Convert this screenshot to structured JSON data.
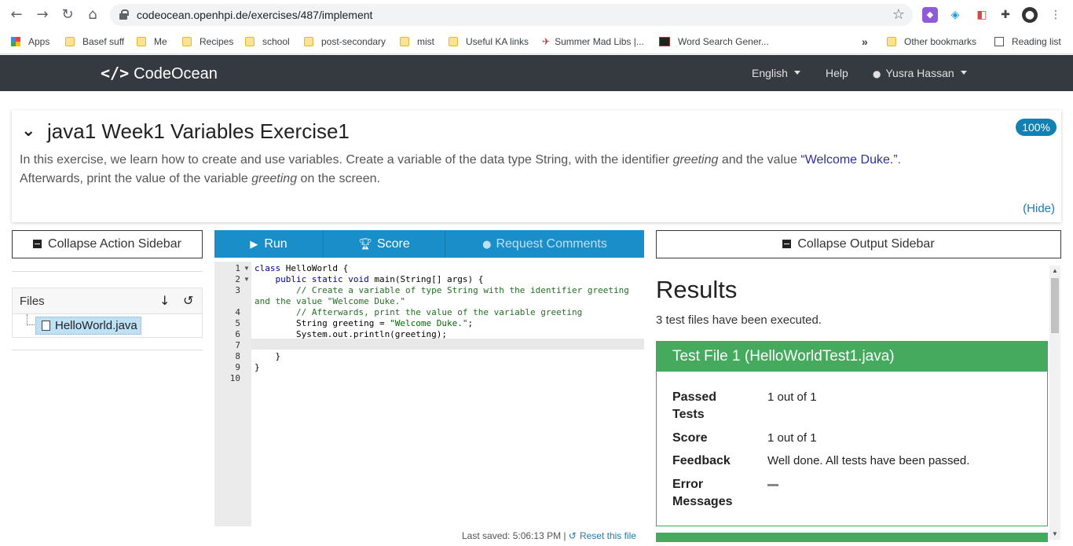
{
  "browser": {
    "url": "codeocean.openhpi.de/exercises/487/implement",
    "bookmarks": [
      "Apps",
      "Basef suff",
      "Me",
      "Recipes",
      "school",
      "post-secondary",
      "mist",
      "Useful KA links",
      "Summer Mad Libs |...",
      "Word Search Gener...",
      "Other bookmarks",
      "Reading list"
    ],
    "more": "»"
  },
  "navbar": {
    "brand": "CodeOcean",
    "brand_logo": "</>",
    "language": "English",
    "help": "Help",
    "user": "Yusra Hassan"
  },
  "exercise": {
    "title": "java1 Week1 Variables Exercise1",
    "progress_badge": "100%",
    "desc_part1": "In this exercise, we learn how to create and use variables. Create a variable of the data type String, with the identifier ",
    "desc_em1": "greeting",
    "desc_part2": " and the value ",
    "desc_quote": "“Welcome Duke.”",
    "desc_part3": ".",
    "desc_part4": "Afterwards, print the value of the variable ",
    "desc_em2": "greeting",
    "desc_part5": " on the screen.",
    "hide_label": "(Hide)"
  },
  "sidebar": {
    "collapse_action": "Collapse Action Sidebar",
    "files_label": "Files",
    "file_name": "HelloWorld.java"
  },
  "toolbar": {
    "run": "Run",
    "score": "Score",
    "request_comments": "Request Comments"
  },
  "editor": {
    "line_numbers": [
      "1",
      "2",
      "3",
      "4",
      "5",
      "6",
      "7",
      "8",
      "9",
      "10"
    ],
    "lines": {
      "l1a": "class",
      "l1b": " HelloWorld {",
      "l2a": "    public static void",
      "l2b": " main(String[] args) {",
      "l3": "        // Create a variable of type String with the identifier greeting",
      "l3b": "and the value \"Welcome Duke.\"",
      "l4": "        // Afterwards, print the value of the variable greeting",
      "l5a": "        String greeting = ",
      "l5b": "\"Welcome Duke.\"",
      "l5c": ";",
      "l6": "        System.out.println(greeting);",
      "l8": "    }",
      "l9": "}"
    },
    "last_saved": "Last saved: 5:06:13 PM | ",
    "reset_label": "Reset this file"
  },
  "output": {
    "collapse_output": "Collapse Output Sidebar",
    "results_title": "Results",
    "results_sub": "3 test files have been executed.",
    "test_file_title": "Test File 1 (HelloWorldTest1.java)",
    "passed_label": "Passed Tests",
    "passed_value": "1 out of 1",
    "score_label": "Score",
    "score_value": "1 out of 1",
    "feedback_label": "Feedback",
    "feedback_value": "Well done. All tests have been passed.",
    "error_label": "Error Messages"
  }
}
